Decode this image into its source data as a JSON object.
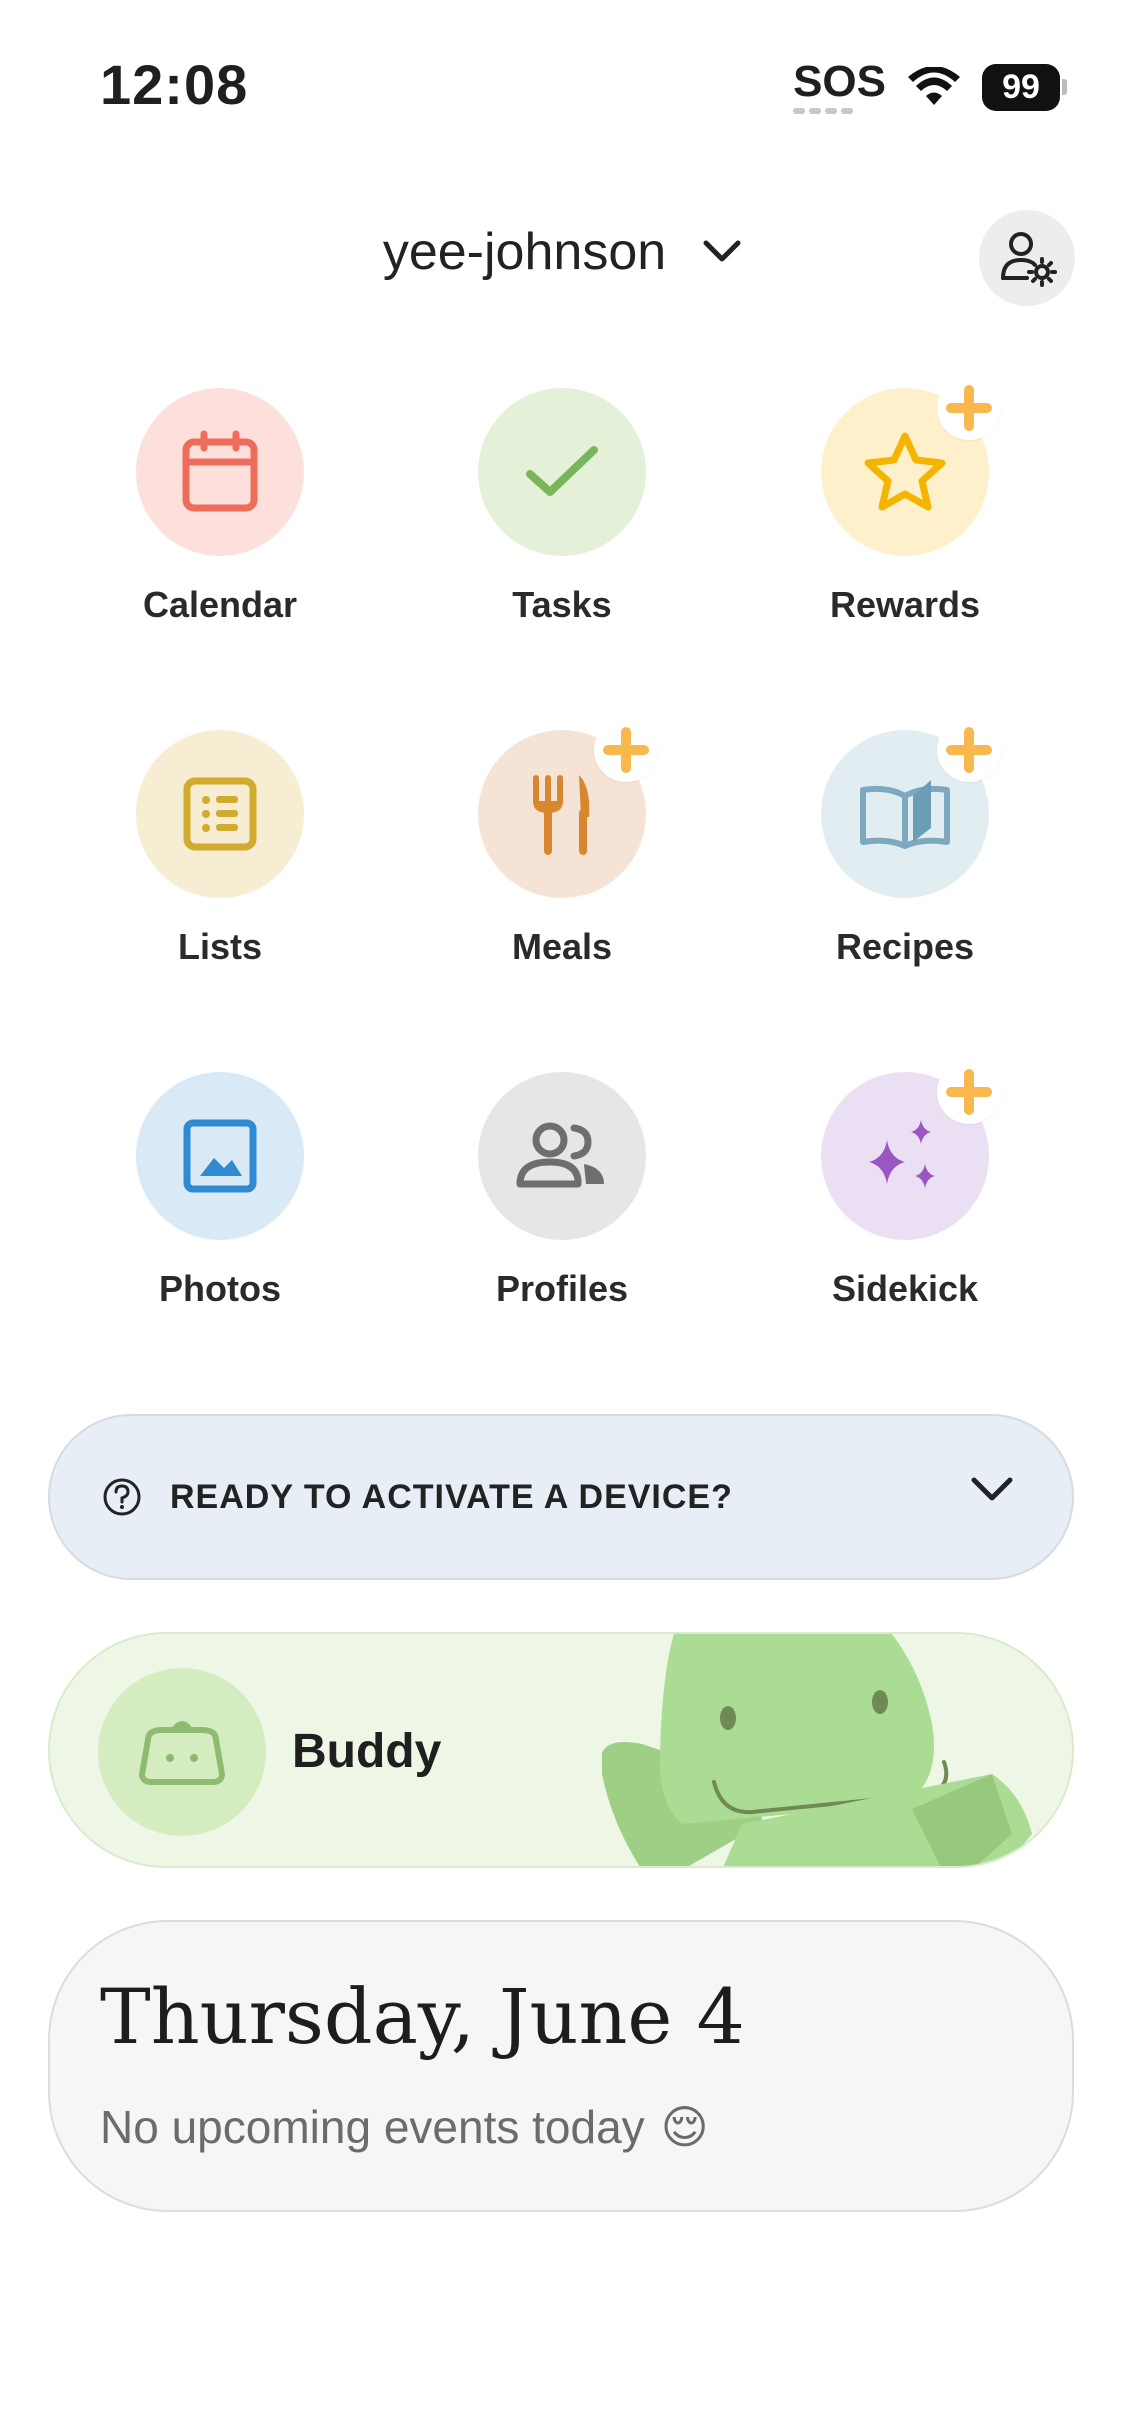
{
  "status_bar": {
    "time": "12:08",
    "carrier": "SOS",
    "battery": "99"
  },
  "header": {
    "family_name": "yee-johnson"
  },
  "apps": [
    {
      "label": "Calendar",
      "icon": "calendar-icon",
      "bg": "#fde0dc",
      "color": "#ef6b5a",
      "plus": false
    },
    {
      "label": "Tasks",
      "icon": "checkmark-icon",
      "bg": "#e5f0d9",
      "color": "#79b55a",
      "plus": false
    },
    {
      "label": "Rewards",
      "icon": "star-icon",
      "bg": "#fff0cc",
      "color": "#f5b400",
      "plus": true
    },
    {
      "label": "Lists",
      "icon": "list-icon",
      "bg": "#f6edd2",
      "color": "#d1ab2e",
      "plus": false
    },
    {
      "label": "Meals",
      "icon": "fork-knife-icon",
      "bg": "#f5e4d6",
      "color": "#d9872e",
      "plus": true
    },
    {
      "label": "Recipes",
      "icon": "book-icon",
      "bg": "#e2edf2",
      "color": "#7da8bf",
      "plus": true
    },
    {
      "label": "Photos",
      "icon": "photo-icon",
      "bg": "#d9e9f5",
      "color": "#2f8ad1",
      "plus": false
    },
    {
      "label": "Profiles",
      "icon": "people-icon",
      "bg": "#e6e6e6",
      "color": "#6e6e6e",
      "plus": false
    },
    {
      "label": "Sidekick",
      "icon": "sparkles-icon",
      "bg": "#ebe0f3",
      "color": "#9a57c4",
      "plus": true
    }
  ],
  "activate_banner": {
    "text": "READY TO ACTIVATE A DEVICE?"
  },
  "buddy": {
    "name": "Buddy"
  },
  "today": {
    "date": "Thursday, June 4",
    "message": "No upcoming events today",
    "emoji": "😌"
  },
  "colors": {
    "plus_badge": "#f8b84e",
    "buddy_green": "#a9d994"
  }
}
